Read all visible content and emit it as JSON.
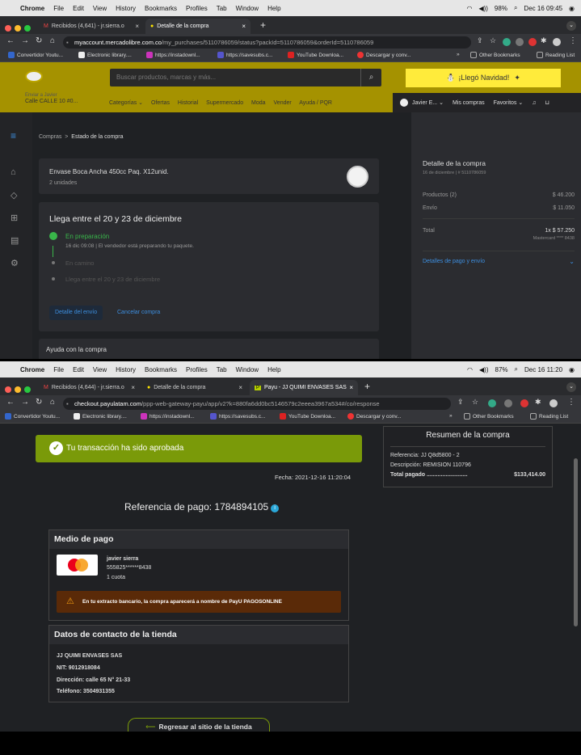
{
  "screen1": {
    "macbar": {
      "apple": "",
      "app": "Chrome",
      "menus": [
        "File",
        "Edit",
        "View",
        "History",
        "Bookmarks",
        "Profiles",
        "Tab",
        "Window",
        "Help"
      ],
      "battery": "98%",
      "clock": "Dec 16  09:45"
    },
    "tabs": [
      {
        "label": "Recibidos (4,641) - jr.sierra.o",
        "close": "×"
      },
      {
        "label": "Detalle de la compra",
        "close": "×"
      }
    ],
    "new_tab": "+",
    "url_host": "myaccount.mercadolibre.com.co",
    "url_path": "/my_purchases/5110786059/status?packId=5110786059&orderId=5110786059",
    "bookmarks": [
      "Convertidor Youtu...",
      "Electronic library....",
      "https://instadownl...",
      "https://savesubs.c...",
      "YouTube Downloa...",
      "Descargar y conv..."
    ],
    "bookmarks_more": "»",
    "other_bookmarks": "Other Bookmarks",
    "reading_list": "Reading List",
    "ml": {
      "search_placeholder": "Buscar productos, marcas y más...",
      "navidad": "¡Llegó Navidad!",
      "loc_label": "Enviar a Javier",
      "loc_value": "Calle CALLE 10 #0...",
      "categories": [
        "Categorías ⌄",
        "Ofertas",
        "Historial",
        "Supermercado",
        "Moda",
        "Vender",
        "Ayuda / PQR"
      ],
      "user": "Javier E... ⌄",
      "mis_compras": "Mis compras",
      "favoritos": "Favoritos ⌄",
      "breadcrumb_1": "Compras",
      "breadcrumb_sep": ">",
      "breadcrumb_2": "Estado de la compra",
      "product_name": "Envase Boca Ancha 450cc Paq. X12unid.",
      "product_qty": "2 unidades",
      "arrival_title": "Llega entre el 20 y 23 de diciembre",
      "steps": [
        {
          "label": "En preparación",
          "detail": "16 dic 09:08 | El vendedor está preparando tu paquete."
        },
        {
          "label": "En camino",
          "detail": ""
        },
        {
          "label": "Llega entre el 20 y 23 de diciembre",
          "detail": ""
        }
      ],
      "btn_detalle": "Detalle del envío",
      "btn_cancelar": "Cancelar compra",
      "ayuda": "Ayuda con la compra",
      "detail_title": "Detalle de la compra",
      "detail_sub": "16 de diciembre  |  # 5110786059",
      "productos_label": "Productos (2)",
      "productos_value": "$ 46.200",
      "envio_label": "Envío",
      "envio_value": "$ 11.050",
      "total_label": "Total",
      "total_value": "1x $ 57.250",
      "total_card": "Mastercard **** 8438",
      "pago_link": "Detalles de pago y envío"
    }
  },
  "screen2": {
    "macbar": {
      "apple": "",
      "app": "Chrome",
      "menus": [
        "File",
        "Edit",
        "View",
        "History",
        "Bookmarks",
        "Profiles",
        "Tab",
        "Window",
        "Help"
      ],
      "battery": "87%",
      "clock": "Dec 16  11:20"
    },
    "tabs": [
      {
        "label": "Recibidos (4,644) - jr.sierra.o",
        "close": "×"
      },
      {
        "label": "Detalle de la compra",
        "close": "×"
      },
      {
        "label": "Payu - JJ QUIMI ENVASES SAS",
        "close": "×"
      }
    ],
    "new_tab": "+",
    "url_host": "checkout.payulatam.com",
    "url_path": "/ppp-web-gateway-payu/app/v2?k=880fa6dd0bc5146579c2eeea3967a534#/co/response",
    "bookmarks": [
      "Convertidor Youtu...",
      "Electronic library....",
      "https://instadownl...",
      "https://savesubs.c...",
      "YouTube Downloa...",
      "Descargar y conv..."
    ],
    "bookmarks_more": "»",
    "other_bookmarks": "Other Bookmarks",
    "reading_list": "Reading List",
    "payu": {
      "approved": "Tu transacción ha sido aprobada",
      "fecha": "Fecha: 2021-12-16  11:20:04",
      "referencia": "Referencia de pago: 1784894105",
      "medio_title": "Medio de pago",
      "card_name": "javier sierra",
      "card_number": "555825******8438",
      "cuotas": "1 cuota",
      "warning": "En tu extracto bancario, la compra aparecerá a nombre de PayU PAGOSONLINE",
      "contacto_title": "Datos de contacto de la tienda",
      "store_name": "JJ QUIMI ENVASES SAS",
      "nit": "NIT: 9012918084",
      "direccion": "Dirección: calle 65 N° 21-33",
      "telefono": "Teléfono: 3504931355",
      "back_button": "Regresar al sitio de la tienda",
      "summary_title": "Resumen de la compra",
      "summary_ref": "Referencia: JJ Q8d5800 - 2",
      "summary_desc": "Descripción: REMISION 110796",
      "summary_total_label": "Total pagado ..........................",
      "summary_total_value": "$133,414.00"
    }
  },
  "colors": {
    "ml_yellow": "#a59200",
    "navidad": "#ffeb3b",
    "payu_green": "#7a9a09",
    "link_blue": "#3d8fe0",
    "step_green": "#39b54a",
    "warning_bg": "#5a2a08"
  }
}
